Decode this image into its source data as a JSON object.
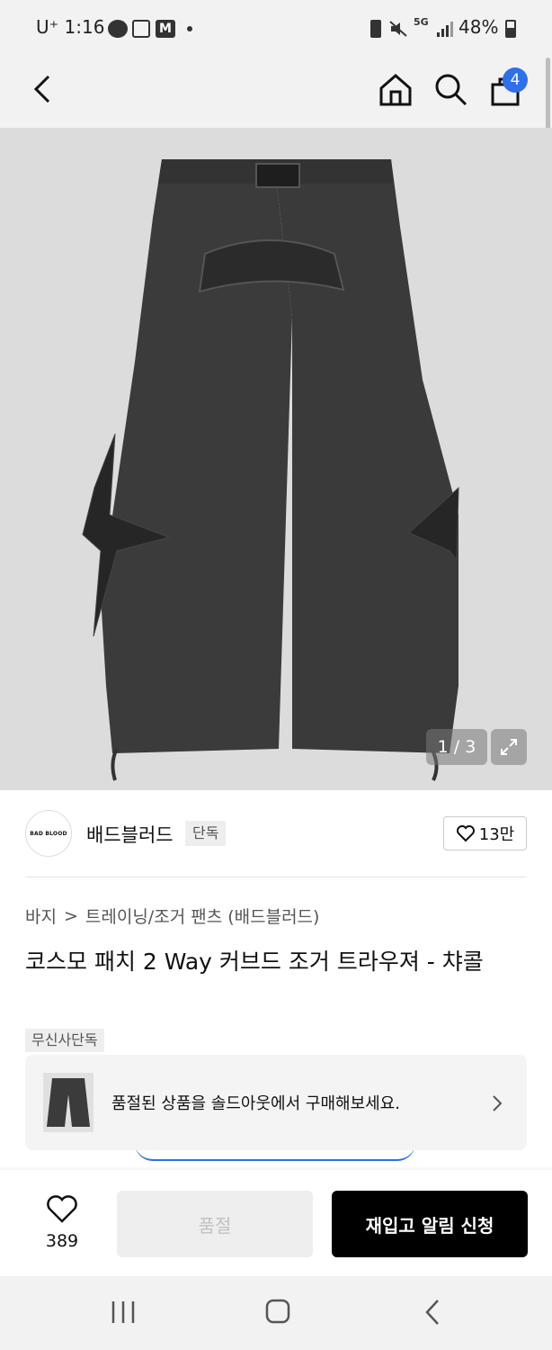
{
  "status_bar": {
    "carrier": "U⁺ 1:16",
    "network": "5G",
    "battery": "48%"
  },
  "header": {
    "cart_count": "4"
  },
  "gallery": {
    "counter": "1 / 3"
  },
  "brand": {
    "logo_text": "BAD BLOOD",
    "name": "배드블러드",
    "exclusive_badge": "단독",
    "likes": "13만"
  },
  "breadcrumb": {
    "category": "바지",
    "separator": ">",
    "subcategory": "트레이닝/조거 팬츠 (배드블러드)"
  },
  "product": {
    "title": "코스모 패치 2 Way 커브드 조거 트라우져 - 챠콜",
    "tag": "무신사단독"
  },
  "soldout_banner": {
    "text": "품절된 상품을 솔드아웃에서 구매해보세요."
  },
  "bottom_bar": {
    "like_count": "389",
    "soldout_label": "품절",
    "restock_label": "재입고 알림 신청"
  },
  "colors": {
    "accent_blue": "#2f6fe8",
    "hero_bg": "#dcdcdc",
    "pants": "#3b3b3b",
    "cta_black": "#000000",
    "disabled_gray": "#eeeeee"
  }
}
